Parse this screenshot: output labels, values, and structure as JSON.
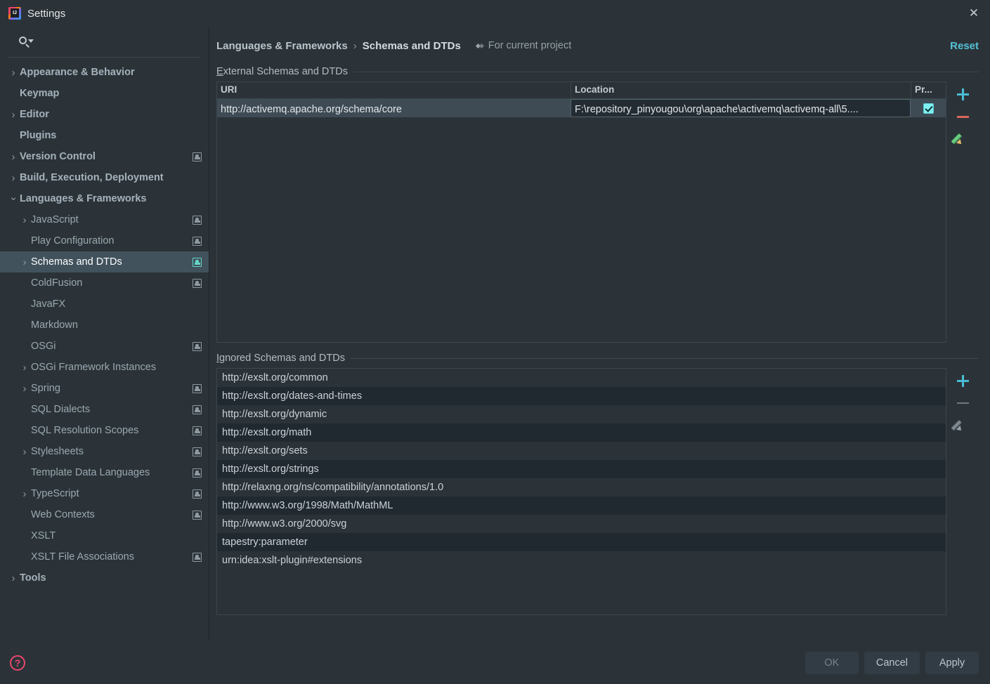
{
  "window": {
    "title": "Settings",
    "app_icon": "intellij-idea-icon",
    "close_label": "✕"
  },
  "sidebar": {
    "search": {
      "placeholder": "",
      "value": "",
      "icon": "search-icon"
    },
    "items": [
      {
        "label": "Appearance & Behavior",
        "level": 0,
        "arrow": "collapsed",
        "bold": true,
        "badge": false,
        "selected": false
      },
      {
        "label": "Keymap",
        "level": 0,
        "arrow": "none",
        "bold": true,
        "badge": false,
        "selected": false
      },
      {
        "label": "Editor",
        "level": 0,
        "arrow": "collapsed",
        "bold": true,
        "badge": false,
        "selected": false
      },
      {
        "label": "Plugins",
        "level": 0,
        "arrow": "none",
        "bold": true,
        "badge": false,
        "selected": false
      },
      {
        "label": "Version Control",
        "level": 0,
        "arrow": "collapsed",
        "bold": true,
        "badge": true,
        "selected": false
      },
      {
        "label": "Build, Execution, Deployment",
        "level": 0,
        "arrow": "collapsed",
        "bold": true,
        "badge": false,
        "selected": false
      },
      {
        "label": "Languages & Frameworks",
        "level": 0,
        "arrow": "expanded",
        "bold": true,
        "badge": false,
        "selected": false
      },
      {
        "label": "JavaScript",
        "level": 1,
        "arrow": "collapsed",
        "bold": false,
        "badge": true,
        "selected": false
      },
      {
        "label": "Play Configuration",
        "level": 1,
        "arrow": "none",
        "bold": false,
        "badge": true,
        "selected": false
      },
      {
        "label": "Schemas and DTDs",
        "level": 1,
        "arrow": "collapsed",
        "bold": false,
        "badge": true,
        "selected": true
      },
      {
        "label": "ColdFusion",
        "level": 1,
        "arrow": "none",
        "bold": false,
        "badge": true,
        "selected": false
      },
      {
        "label": "JavaFX",
        "level": 1,
        "arrow": "none",
        "bold": false,
        "badge": false,
        "selected": false
      },
      {
        "label": "Markdown",
        "level": 1,
        "arrow": "none",
        "bold": false,
        "badge": false,
        "selected": false
      },
      {
        "label": "OSGi",
        "level": 1,
        "arrow": "none",
        "bold": false,
        "badge": true,
        "selected": false
      },
      {
        "label": "OSGi Framework Instances",
        "level": 1,
        "arrow": "collapsed",
        "bold": false,
        "badge": false,
        "selected": false
      },
      {
        "label": "Spring",
        "level": 1,
        "arrow": "collapsed",
        "bold": false,
        "badge": true,
        "selected": false
      },
      {
        "label": "SQL Dialects",
        "level": 1,
        "arrow": "none",
        "bold": false,
        "badge": true,
        "selected": false
      },
      {
        "label": "SQL Resolution Scopes",
        "level": 1,
        "arrow": "none",
        "bold": false,
        "badge": true,
        "selected": false
      },
      {
        "label": "Stylesheets",
        "level": 1,
        "arrow": "collapsed",
        "bold": false,
        "badge": true,
        "selected": false
      },
      {
        "label": "Template Data Languages",
        "level": 1,
        "arrow": "none",
        "bold": false,
        "badge": true,
        "selected": false
      },
      {
        "label": "TypeScript",
        "level": 1,
        "arrow": "collapsed",
        "bold": false,
        "badge": true,
        "selected": false
      },
      {
        "label": "Web Contexts",
        "level": 1,
        "arrow": "none",
        "bold": false,
        "badge": true,
        "selected": false
      },
      {
        "label": "XSLT",
        "level": 1,
        "arrow": "none",
        "bold": false,
        "badge": false,
        "selected": false
      },
      {
        "label": "XSLT File Associations",
        "level": 1,
        "arrow": "none",
        "bold": false,
        "badge": true,
        "selected": false
      },
      {
        "label": "Tools",
        "level": 0,
        "arrow": "collapsed",
        "bold": true,
        "badge": false,
        "selected": false
      }
    ]
  },
  "main": {
    "breadcrumb": {
      "parent": "Languages & Frameworks",
      "separator": "›",
      "current": "Schemas and DTDs"
    },
    "scope": {
      "icon": "project-scope-icon",
      "label": "For current project"
    },
    "reset_label": "Reset",
    "external": {
      "group_label_mnemonic": "E",
      "group_label_rest": "xternal Schemas and DTDs",
      "columns": [
        "URI",
        "Location",
        "Pr..."
      ],
      "rows": [
        {
          "uri": "http://activemq.apache.org/schema/core",
          "location": "F:\\repository_pinyougou\\org\\apache\\activemq\\activemq-all\\5....",
          "project_checked": true,
          "selected": true
        }
      ],
      "toolbar": [
        {
          "name": "add-external-schema-button",
          "icon": "plus-icon",
          "enabled": true
        },
        {
          "name": "remove-external-schema-button",
          "icon": "minus-icon",
          "enabled": true
        },
        {
          "name": "edit-external-schema-button",
          "icon": "pencil-icon",
          "enabled": true
        }
      ]
    },
    "ignored": {
      "group_label_mnemonic": "I",
      "group_label_rest": "gnored Schemas and DTDs",
      "items": [
        "http://exslt.org/common",
        "http://exslt.org/dates-and-times",
        "http://exslt.org/dynamic",
        "http://exslt.org/math",
        "http://exslt.org/sets",
        "http://exslt.org/strings",
        "http://relaxng.org/ns/compatibility/annotations/1.0",
        "http://www.w3.org/1998/Math/MathML",
        "http://www.w3.org/2000/svg",
        "tapestry:parameter",
        "urn:idea:xslt-plugin#extensions"
      ],
      "toolbar": [
        {
          "name": "add-ignored-schema-button",
          "icon": "plus-icon",
          "enabled": true
        },
        {
          "name": "remove-ignored-schema-button",
          "icon": "minus-icon",
          "enabled": false
        },
        {
          "name": "edit-ignored-schema-button",
          "icon": "pencil-icon",
          "enabled": false
        }
      ]
    }
  },
  "footer": {
    "help_icon": "help-question-icon",
    "help_glyph": "?",
    "buttons": [
      {
        "label": "OK",
        "enabled": false
      },
      {
        "label": "Cancel",
        "enabled": true
      },
      {
        "label": "Apply",
        "enabled": true
      }
    ]
  },
  "colors": {
    "window_bg": "#2b3338",
    "accent_cyan": "#4bbcd4",
    "reset_link": "#56c1d6",
    "selection_bg": "#41525c",
    "checkbox_fill": "#7ef0f0",
    "remove_red": "#d9655a",
    "help_red": "#e8476b",
    "row_stripe": "#212930"
  }
}
